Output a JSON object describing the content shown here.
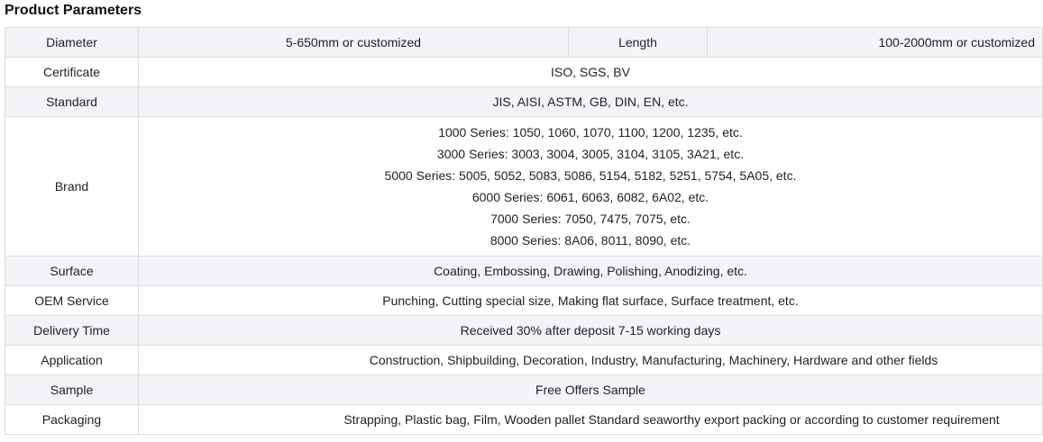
{
  "title": "Product Parameters",
  "rows": {
    "diameter": {
      "label": "Diameter",
      "value": "5-650mm or customized",
      "label2": "Length",
      "value2": "100-2000mm or customized"
    },
    "certificate": {
      "label": "Certificate",
      "value": "ISO, SGS, BV"
    },
    "standard": {
      "label": "Standard",
      "value": "JIS, AISI, ASTM, GB, DIN, EN, etc."
    },
    "brand": {
      "label": "Brand",
      "lines": [
        "1000 Series: 1050, 1060, 1070, 1100, 1200, 1235, etc.",
        "3000 Series: 3003, 3004, 3005, 3104, 3105, 3A21, etc.",
        "5000 Series: 5005, 5052, 5083, 5086, 5154, 5182, 5251, 5754, 5A05, etc.",
        "6000 Series: 6061, 6063, 6082, 6A02, etc.",
        "7000 Series: 7050, 7475, 7075, etc.",
        "8000 Series: 8A06, 8011, 8090, etc."
      ]
    },
    "surface": {
      "label": "Surface",
      "value": "Coating, Embossing, Drawing, Polishing, Anodizing, etc."
    },
    "oem": {
      "label": "OEM Service",
      "value": "Punching, Cutting special size, Making flat surface, Surface treatment, etc."
    },
    "delivery": {
      "label": "Delivery Time",
      "value": "Received 30% after deposit 7-15 working days"
    },
    "application": {
      "label": "Application",
      "value": "Construction, Shipbuilding, Decoration, Industry, Manufacturing, Machinery, Hardware and other fields"
    },
    "sample": {
      "label": "Sample",
      "value": "Free Offers Sample"
    },
    "packaging": {
      "label": "Packaging",
      "value": "Strapping, Plastic bag, Film, Wooden pallet Standard seaworthy export packing or according to customer requirement"
    }
  }
}
